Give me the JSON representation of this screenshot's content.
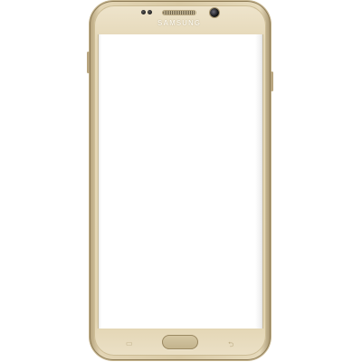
{
  "device": {
    "brand_logo": "SAMSUNG",
    "color": "#d9caa6",
    "accent": "#b6a37b",
    "screen_color": "#ffffff"
  },
  "icons": {
    "recent_apps": "recent-apps-icon",
    "back": "back-icon",
    "front_camera": "camera-icon",
    "speaker": "speaker-grille-icon"
  },
  "nav": {
    "recent_glyph": "▭",
    "back_glyph": "⮌"
  }
}
